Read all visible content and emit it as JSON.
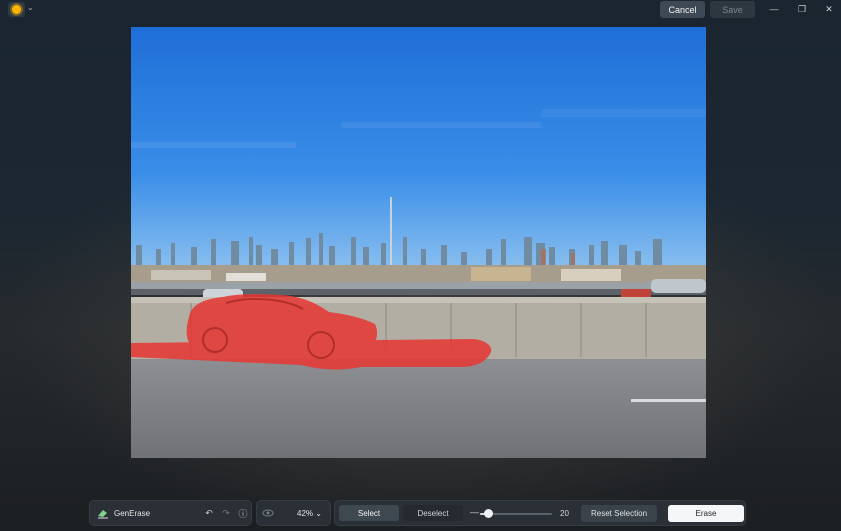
{
  "titlebar": {
    "logo_icon": "sun-logo-icon",
    "cancel_label": "Cancel",
    "save_label": "Save",
    "minimize_glyph": "—",
    "maximize_glyph": "❐",
    "close_glyph": "✕"
  },
  "canvas": {
    "content": "photo-with-red-selection-mask",
    "mask_color": "#e53935"
  },
  "toolbar": {
    "tool_name": "GenErase",
    "zoom_label": "42%",
    "zoom_chevron": "⌄",
    "select_label": "Select",
    "deselect_label": "Deselect",
    "brush_minus": "—",
    "brush_size": "20",
    "brush_fraction": 0.12,
    "reset_label": "Reset Selection",
    "erase_label": "Erase"
  },
  "colors": {
    "accent_sun": "#ffb300",
    "primary_button_bg": "#f5f6f7",
    "mask": "#e53935"
  }
}
